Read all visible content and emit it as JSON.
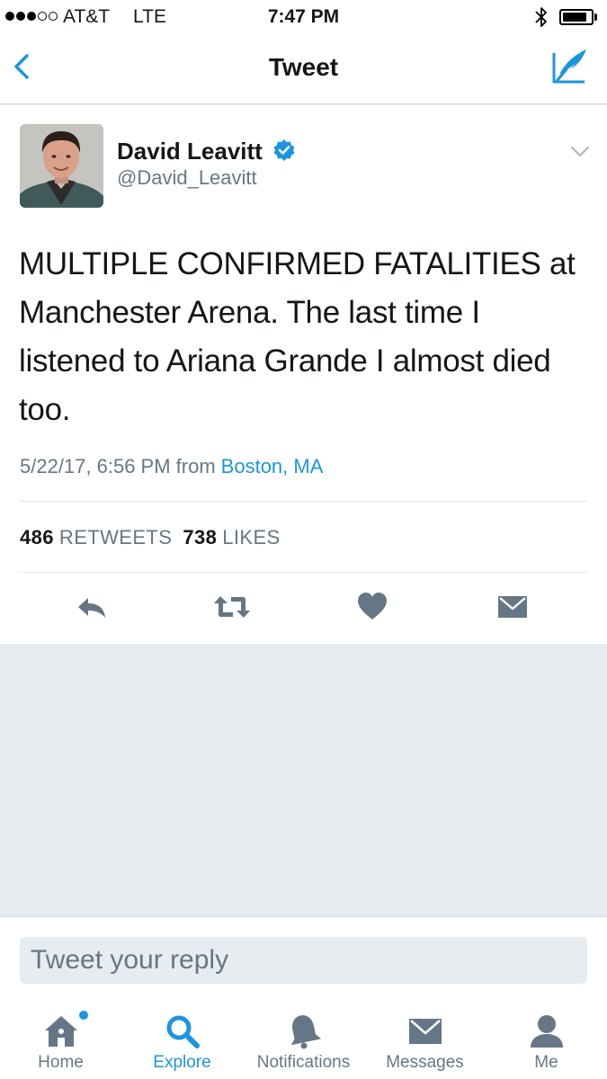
{
  "status_bar": {
    "carrier": "AT&T",
    "network": "LTE",
    "time": "7:47 PM",
    "signal_bars_filled": 3,
    "signal_bars_total": 5,
    "battery_level": 0.75
  },
  "nav": {
    "title": "Tweet",
    "back_icon": "chevron-left-icon",
    "compose_icon": "compose-tweet-icon"
  },
  "tweet": {
    "author": {
      "display_name": "David Leavitt",
      "handle": "@David_Leavitt",
      "verified": true
    },
    "text": "MULTIPLE CONFIRMED FATALITIES at Manchester Arena. The last time I listened to Ariana Grande I almost died too.",
    "timestamp": "5/22/17, 6:56 PM from",
    "location": "Boston, MA",
    "retweet_count": "486",
    "retweet_label": "RETWEETS",
    "like_count": "738",
    "like_label": "LIKES",
    "actions": [
      "reply-icon",
      "retweet-icon",
      "heart-icon",
      "direct-message-icon"
    ]
  },
  "reply": {
    "placeholder": "Tweet your reply"
  },
  "tabs": [
    {
      "label": "Home",
      "icon": "home-icon",
      "active": false,
      "notification_dot": true
    },
    {
      "label": "Explore",
      "icon": "search-icon",
      "active": true,
      "notification_dot": false
    },
    {
      "label": "Notifications",
      "icon": "bell-icon",
      "active": false,
      "notification_dot": false
    },
    {
      "label": "Messages",
      "icon": "envelope-icon",
      "active": false,
      "notification_dot": false
    },
    {
      "label": "Me",
      "icon": "person-icon",
      "active": false,
      "notification_dot": false
    }
  ],
  "colors": {
    "accent": "#1b95e0",
    "secondary_text": "#657786",
    "background": "#e6ecf0",
    "icon_gray": "#657786"
  }
}
